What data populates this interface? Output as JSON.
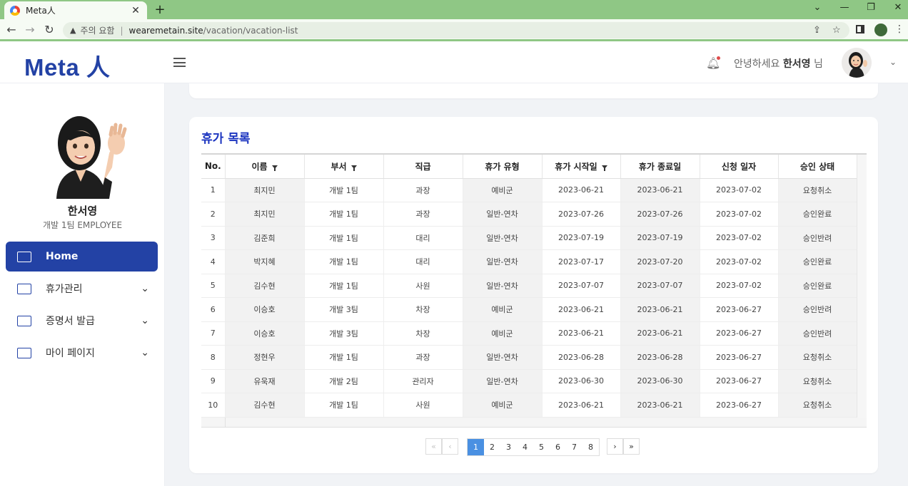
{
  "browser": {
    "tab_title": "Meta人",
    "omnibox_warning": "주의 요함",
    "url_host": "wearemetain.site",
    "url_path": "/vacation/vacation-list"
  },
  "header": {
    "logo": "Meta 人",
    "greeting_prefix": "안녕하세요",
    "user_name": "한서영",
    "greeting_suffix": "님"
  },
  "sidebar": {
    "profile_name": "한서영",
    "profile_dept": "개발 1팀 EMPLOYEE",
    "items": [
      {
        "label": "Home"
      },
      {
        "label": "휴가관리"
      },
      {
        "label": "증명서 발급"
      },
      {
        "label": "마이 페이지"
      }
    ]
  },
  "main": {
    "title": "휴가 목록",
    "columns": [
      "No.",
      "이름",
      "부서",
      "직급",
      "휴가 유형",
      "휴가 시작일",
      "휴가 종료일",
      "신청 일자",
      "승인 상태"
    ],
    "rows": [
      [
        "1",
        "최지민",
        "개발 1팀",
        "과장",
        "예비군",
        "2023-06-21",
        "2023-06-21",
        "2023-07-02",
        "요청취소"
      ],
      [
        "2",
        "최지민",
        "개발 1팀",
        "과장",
        "일반-연차",
        "2023-07-26",
        "2023-07-26",
        "2023-07-02",
        "승인완료"
      ],
      [
        "3",
        "김준희",
        "개발 1팀",
        "대리",
        "일반-연차",
        "2023-07-19",
        "2023-07-19",
        "2023-07-02",
        "승인반려"
      ],
      [
        "4",
        "박지혜",
        "개발 1팀",
        "대리",
        "일반-연차",
        "2023-07-17",
        "2023-07-20",
        "2023-07-02",
        "승인완료"
      ],
      [
        "5",
        "김수현",
        "개발 1팀",
        "사원",
        "일반-연차",
        "2023-07-07",
        "2023-07-07",
        "2023-07-02",
        "승인완료"
      ],
      [
        "6",
        "이승호",
        "개발 3팀",
        "차장",
        "예비군",
        "2023-06-21",
        "2023-06-21",
        "2023-06-27",
        "승인반려"
      ],
      [
        "7",
        "이승호",
        "개발 3팀",
        "차장",
        "예비군",
        "2023-06-21",
        "2023-06-21",
        "2023-06-27",
        "승인반려"
      ],
      [
        "8",
        "정현우",
        "개발 1팀",
        "과장",
        "일반-연차",
        "2023-06-28",
        "2023-06-28",
        "2023-06-27",
        "요청취소"
      ],
      [
        "9",
        "유욱재",
        "개발 2팀",
        "관리자",
        "일반-연차",
        "2023-06-30",
        "2023-06-30",
        "2023-06-27",
        "요청취소"
      ],
      [
        "10",
        "김수현",
        "개발 1팀",
        "사원",
        "예비군",
        "2023-06-21",
        "2023-06-21",
        "2023-06-27",
        "요청취소"
      ]
    ],
    "pagination": {
      "first": "«",
      "prev": "‹",
      "pages": [
        "1",
        "2",
        "3",
        "4",
        "5",
        "6",
        "7",
        "8"
      ],
      "current": "1",
      "next": "›",
      "last": "»"
    }
  },
  "colors": {
    "brand": "#2342a5",
    "title": "#1d36c0",
    "pager_active": "#4a90e2",
    "browser_frame": "#8fc785"
  }
}
